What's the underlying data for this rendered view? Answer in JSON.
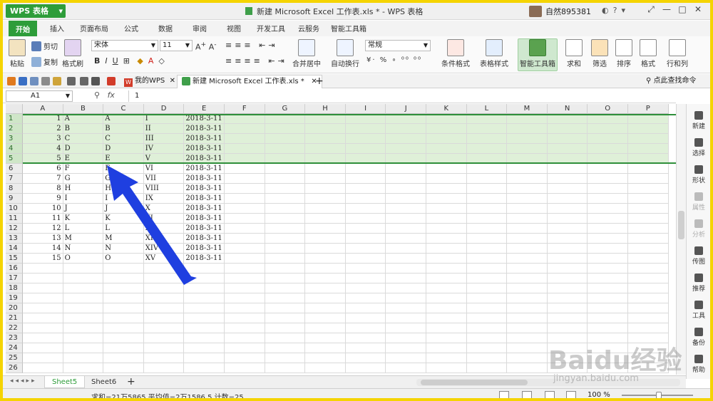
{
  "app": {
    "button_label": "WPS 表格",
    "window_title": "新建 Microsoft Excel 工作表.xls * - WPS 表格",
    "user_name": "自然895381"
  },
  "ribbon_tabs": [
    "开始",
    "插入",
    "页面布局",
    "公式",
    "数据",
    "审阅",
    "视图",
    "开发工具",
    "云服务",
    "智能工具箱"
  ],
  "ribbon": {
    "cut": "剪切",
    "paste": "粘贴",
    "copy": "复制",
    "format_painter": "格式刷",
    "font_name": "宋体",
    "font_size": "11",
    "merge_center": "合并居中",
    "wrap_text": "自动换行",
    "number_format": "常规",
    "conditional_format": "条件格式",
    "table_style": "表格样式",
    "smart_toolbox": "智能工具箱",
    "sum": "求和",
    "filter": "筛选",
    "sort": "排序",
    "format": "格式",
    "row_col": "行和列"
  },
  "doc_tabs": {
    "my_wps": "我的WPS",
    "current_file": "新建 Microsoft Excel 工作表.xls *",
    "search": "点此查找命令"
  },
  "formula_bar": {
    "cell_ref": "A1",
    "fx": "fx",
    "value": "1"
  },
  "columns": [
    "A",
    "B",
    "C",
    "D",
    "E",
    "F",
    "G",
    "H",
    "I",
    "J",
    "K",
    "L",
    "M",
    "N",
    "O",
    "P"
  ],
  "rows": [
    [
      "1",
      "A",
      "A",
      "I",
      "2018-3-11"
    ],
    [
      "2",
      "B",
      "B",
      "II",
      "2018-3-11"
    ],
    [
      "3",
      "C",
      "C",
      "III",
      "2018-3-11"
    ],
    [
      "4",
      "D",
      "D",
      "IV",
      "2018-3-11"
    ],
    [
      "5",
      "E",
      "E",
      "V",
      "2018-3-11"
    ],
    [
      "6",
      "F",
      "F",
      "VI",
      "2018-3-11"
    ],
    [
      "7",
      "G",
      "G",
      "VII",
      "2018-3-11"
    ],
    [
      "8",
      "H",
      "H",
      "VIII",
      "2018-3-11"
    ],
    [
      "9",
      "I",
      "I",
      "IX",
      "2018-3-11"
    ],
    [
      "10",
      "J",
      "J",
      "X",
      "2018-3-11"
    ],
    [
      "11",
      "K",
      "K",
      "XI",
      "2018-3-11"
    ],
    [
      "12",
      "L",
      "L",
      "XII",
      "2018-3-11"
    ],
    [
      "13",
      "M",
      "M",
      "XIII",
      "2018-3-11"
    ],
    [
      "14",
      "N",
      "N",
      "XIV",
      "2018-3-11"
    ],
    [
      "15",
      "O",
      "O",
      "XV",
      "2018-3-11"
    ]
  ],
  "total_rows_visible": 26,
  "selected_rows": [
    1,
    2,
    3,
    4,
    5
  ],
  "side_panel": [
    "新建",
    "选择",
    "形状",
    "属性",
    "分析",
    "传图",
    "推荐",
    "工具",
    "备份",
    "帮助"
  ],
  "sheets": [
    "Sheet5",
    "Sheet6"
  ],
  "status": {
    "summary": "求和=21万5865  平均值=2万1586.5  计数=25",
    "zoom": "100 %"
  },
  "watermark": {
    "main": "Baidu经验",
    "sub": "jingyan.baidu.com"
  },
  "colors": {
    "accent_green": "#2e9d3a",
    "selection_fill": "#dff0d8",
    "arrow_blue": "#1f3fe0",
    "frame_yellow": "#f5d400"
  }
}
